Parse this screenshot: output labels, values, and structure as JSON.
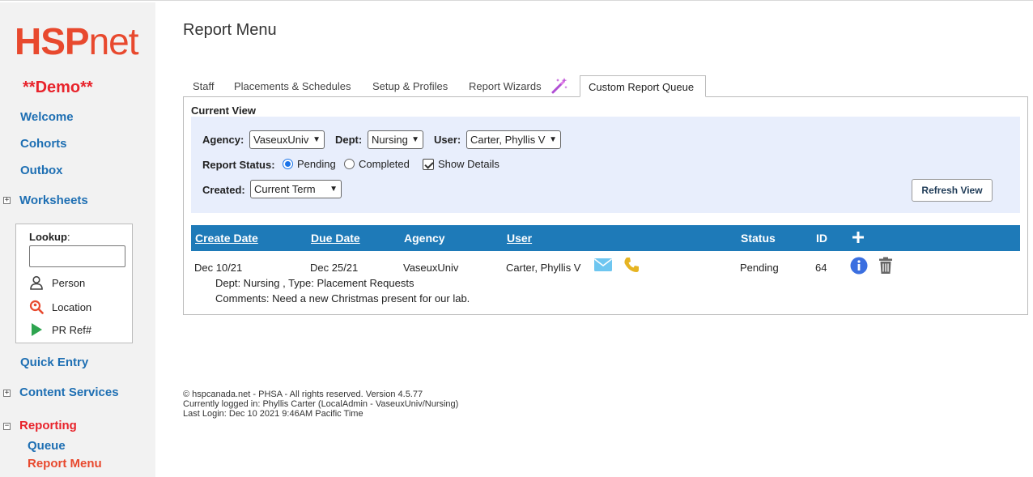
{
  "logo": {
    "part1": "HSP",
    "part2": "net"
  },
  "demo_label": "**Demo**",
  "sidebar": {
    "welcome": "Welcome",
    "cohorts": "Cohorts",
    "outbox": "Outbox",
    "worksheets": "Worksheets",
    "lookup": {
      "label": "Lookup",
      "colon": ":",
      "input_value": "",
      "person": "Person",
      "location": "Location",
      "pr_ref": "PR Ref#"
    },
    "quick_entry": "Quick Entry",
    "content_services": "Content Services",
    "reporting": "Reporting",
    "queue": "Queue",
    "report_menu": "Report Menu",
    "plus_glyph": "+",
    "minus_glyph": "−"
  },
  "page_title": "Report Menu",
  "tabs": [
    {
      "label": "Staff",
      "active": false
    },
    {
      "label": "Placements & Schedules",
      "active": false
    },
    {
      "label": "Setup & Profiles",
      "active": false
    },
    {
      "label": "Report Wizards",
      "active": false
    },
    {
      "label": "Custom Report Queue",
      "active": true
    }
  ],
  "current_view": {
    "title": "Current View",
    "agency_label": "Agency:",
    "agency_value": "VaseuxUniv",
    "dept_label": "Dept:",
    "dept_value": "Nursing",
    "user_label": "User:",
    "user_value": "Carter, Phyllis V",
    "status_label": "Report Status:",
    "pending_label": "Pending",
    "pending_selected": true,
    "completed_label": "Completed",
    "show_details_label": "Show Details",
    "show_details_checked": true,
    "created_label": "Created:",
    "created_value": "Current Term",
    "refresh_label": "Refresh View"
  },
  "table": {
    "headers": {
      "create_date": "Create Date",
      "due_date": "Due Date",
      "agency": "Agency",
      "user": "User",
      "status": "Status",
      "id": "ID"
    },
    "rows": [
      {
        "create_date": "Dec 10/21",
        "due_date": "Dec 25/21",
        "agency": "VaseuxUniv",
        "user": "Carter, Phyllis V",
        "status": "Pending",
        "id": "64",
        "details_line1": "Dept: Nursing ,    Type: Placement Requests",
        "details_line2": "Comments: Need a new Christmas present for our lab."
      }
    ]
  },
  "footer": {
    "line1": "© hspcanada.net - PHSA - All rights reserved.    Version 4.5.77",
    "line2": "Currently logged in: Phyllis Carter (LocalAdmin - VaseuxUniv/Nursing)",
    "line3": "Last Login: Dec 10 2021  9:46AM Pacific Time"
  },
  "colors": {
    "brand_red": "#e8492e",
    "link_blue": "#1e6fb3",
    "header_blue": "#1e7ab8",
    "filter_bg": "#e8eefc"
  },
  "icons": {
    "wand": "magic-wand-icon",
    "mail": "envelope-icon",
    "phone": "phone-icon",
    "info": "info-icon",
    "trash": "trash-icon",
    "plus": "plus-icon"
  }
}
